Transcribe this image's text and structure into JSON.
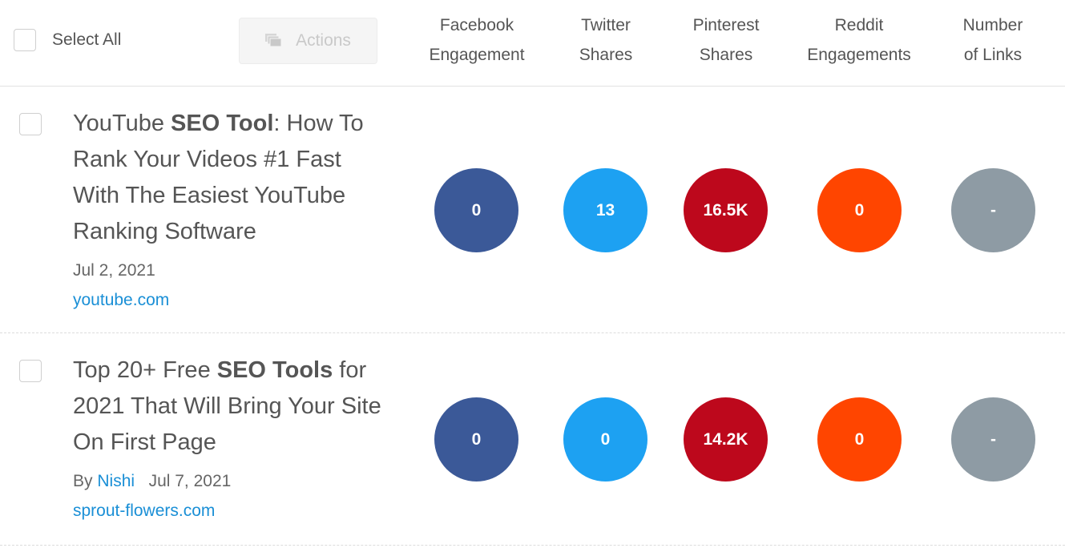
{
  "toolbar": {
    "select_all_label": "Select All",
    "actions_label": "Actions",
    "actions_icon": "stack-icon"
  },
  "columns": [
    {
      "line1": "Facebook",
      "line2": "Engagement"
    },
    {
      "line1": "Twitter",
      "line2": "Shares"
    },
    {
      "line1": "Pinterest",
      "line2": "Shares"
    },
    {
      "line1": "Reddit",
      "line2": "Engagements"
    },
    {
      "line1": "Number",
      "line2": "of Links"
    }
  ],
  "colors": {
    "facebook": "#3b5998",
    "twitter": "#1da1f2",
    "pinterest": "#bd081c",
    "reddit": "#ff4500",
    "links": "#8e9ba4",
    "link_text": "#1a8fd6"
  },
  "rows": [
    {
      "title_pre": "YouTube ",
      "title_bold": "SEO Tool",
      "title_post": ": How To Rank Your Videos #1 Fast With The Easiest YouTube Ranking Software",
      "by": "",
      "author": "",
      "date": "Jul 2, 2021",
      "domain": "youtube.com",
      "metrics": {
        "facebook": "0",
        "twitter": "13",
        "pinterest": "16.5K",
        "reddit": "0",
        "links": "-"
      }
    },
    {
      "title_pre": "Top 20+ Free ",
      "title_bold": "SEO Tools",
      "title_post": " for 2021 That Will Bring Your Site On First Page",
      "by": "By",
      "author": "Nishi",
      "date": "Jul 7, 2021",
      "domain": "sprout-flowers.com",
      "metrics": {
        "facebook": "0",
        "twitter": "0",
        "pinterest": "14.2K",
        "reddit": "0",
        "links": "-"
      }
    }
  ]
}
